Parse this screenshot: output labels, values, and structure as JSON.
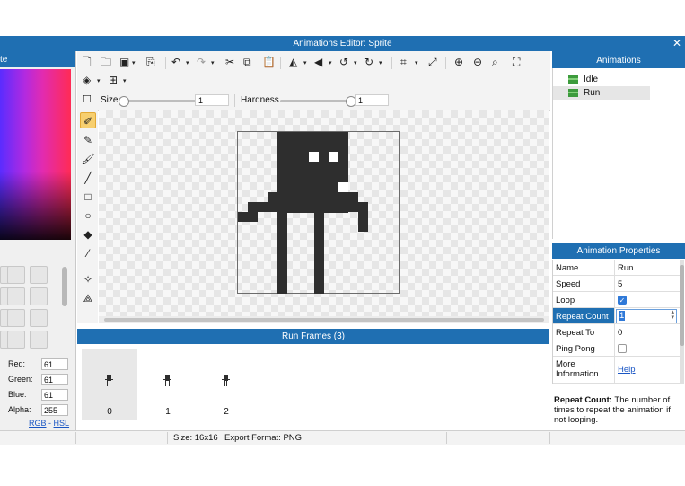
{
  "window": {
    "title": "Animations Editor: Sprite",
    "close_glyph": "✕"
  },
  "palette": {
    "header_label": "te",
    "channels": [
      {
        "label": "Red:",
        "value": "61"
      },
      {
        "label": "Green:",
        "value": "61"
      },
      {
        "label": "Blue:",
        "value": "61"
      },
      {
        "label": "Alpha:",
        "value": "255"
      }
    ],
    "mode_rgb": "RGB",
    "mode_sep": " - ",
    "mode_hsl": "HSL"
  },
  "toolbar": {
    "size_label": "Size",
    "size_value": "1",
    "hardness_label": "Hardness",
    "hardness_value": "1",
    "icons": [
      "new-file-icon",
      "open-folder-icon",
      "save-icon",
      "export-icon",
      "undo-icon",
      "redo-icon",
      "cut-icon",
      "copy-icon",
      "paste-icon",
      "flip-horizontal-icon",
      "flip-vertical-icon",
      "rotate-left-icon",
      "rotate-right-icon",
      "crop-icon",
      "resize-icon",
      "zoom-in-icon",
      "zoom-out-icon",
      "zoom-fit-icon",
      "zoom-actual-icon",
      "layers-icon",
      "grid-icon"
    ]
  },
  "tools": [
    "eraser-icon",
    "pencil-icon",
    "brush-icon",
    "line-icon",
    "rectangle-icon",
    "ellipse-icon",
    "fill-bucket-icon",
    "eyedropper-icon",
    "selection-icon",
    "move-points-icon"
  ],
  "frames": {
    "header": "Run Frames (3)",
    "items": [
      {
        "label": "0"
      },
      {
        "label": "1"
      },
      {
        "label": "2"
      }
    ]
  },
  "animations": {
    "header": "Animations",
    "items": [
      {
        "label": "Idle"
      },
      {
        "label": "Run"
      }
    ]
  },
  "properties": {
    "header": "Animation Properties",
    "rows": [
      {
        "key": "Name",
        "value": "Run"
      },
      {
        "key": "Speed",
        "value": "5"
      },
      {
        "key": "Loop",
        "value": ""
      },
      {
        "key": "Repeat Count",
        "value": "1"
      },
      {
        "key": "Repeat To",
        "value": "0"
      },
      {
        "key": "Ping Pong",
        "value": ""
      },
      {
        "key": "More Information",
        "value": "Help"
      }
    ],
    "help_title": "Repeat Count:",
    "help_body": "The number of times to repeat the animation if not looping."
  },
  "status": {
    "size": "Size: 16x16",
    "format": "Export Format: PNG"
  },
  "colors": {
    "accent": "#1f6fb2",
    "sprite": "#2e2e2e",
    "active_tool": "#f7cf6f"
  }
}
